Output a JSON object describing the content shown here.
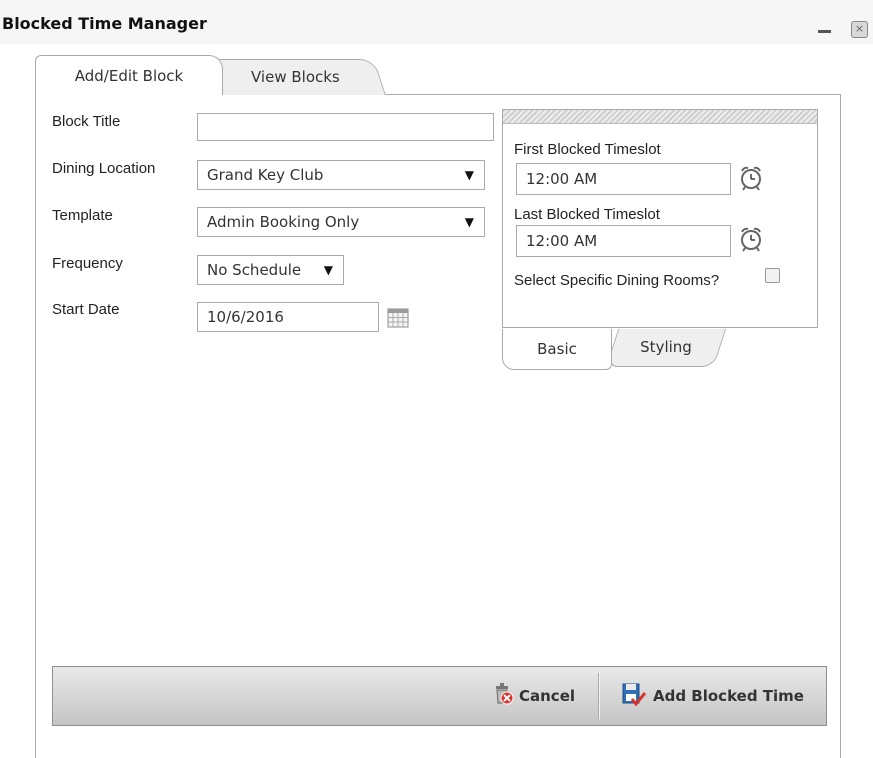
{
  "window": {
    "title": "Blocked Time Manager",
    "minimize_icon": "minimize-icon",
    "close_icon": "close-icon"
  },
  "tabs": [
    {
      "label": "Add/Edit Block",
      "active": true
    },
    {
      "label": "View Blocks",
      "active": false
    }
  ],
  "form": {
    "block_title": {
      "label": "Block Title",
      "value": ""
    },
    "dining_location": {
      "label": "Dining Location",
      "value": "Grand Key Club"
    },
    "template": {
      "label": "Template",
      "value": "Admin Booking Only"
    },
    "frequency": {
      "label": "Frequency",
      "value": "No Schedule"
    },
    "start_date": {
      "label": "Start Date",
      "value": "10/6/2016"
    },
    "select_arrow": "▼"
  },
  "timeslots": {
    "first_label": "First Blocked Timeslot",
    "first_value": "12:00 AM",
    "last_label": "Last Blocked Timeslot",
    "last_value": "12:00 AM",
    "rooms_label": "Select Specific Dining Rooms?",
    "rooms_checked": false
  },
  "panel_tabs": [
    {
      "label": "Basic",
      "active": true
    },
    {
      "label": "Styling",
      "active": false
    }
  ],
  "footer": {
    "cancel_label": "Cancel",
    "add_label": "Add Blocked Time"
  },
  "colors": {
    "cancel_icon_red": "#d9342b",
    "add_icon_blue": "#2f6fb6"
  }
}
